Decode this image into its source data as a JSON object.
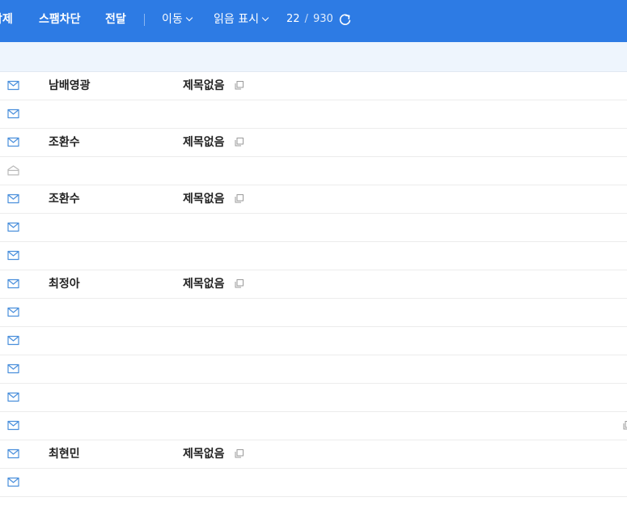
{
  "toolbar": {
    "delete_label": "삭제",
    "spam_label": "스팸차단",
    "forward_label": "전달",
    "move_label": "이동",
    "mark_label": "읽음 표시",
    "page_current": "22",
    "page_separator": "/",
    "page_total": "930",
    "refresh_icon": "refresh-icon",
    "bg_color": "#2d7be4"
  },
  "mail_list": {
    "rows": [
      {
        "sender": "남배영광",
        "subject": "제목없음",
        "icon": "envelope-icon"
      },
      {
        "sender": "",
        "subject": "",
        "icon": "envelope-icon"
      },
      {
        "sender": "조환수",
        "subject": "제목없음",
        "icon": "envelope-icon"
      },
      {
        "sender": "",
        "subject": "",
        "icon": "envelope-open-icon"
      },
      {
        "sender": "조환수",
        "subject": "제목없음",
        "icon": "envelope-icon"
      },
      {
        "sender": "",
        "subject": "",
        "icon": "envelope-icon"
      },
      {
        "sender": "",
        "subject": "",
        "icon": "envelope-icon"
      },
      {
        "sender": "최정아",
        "subject": "제목없음",
        "icon": "envelope-icon"
      },
      {
        "sender": "",
        "subject": "",
        "icon": "envelope-icon"
      },
      {
        "sender": "",
        "subject": "",
        "icon": "envelope-icon"
      },
      {
        "sender": "",
        "subject": "",
        "icon": "envelope-icon"
      },
      {
        "sender": "",
        "subject": "",
        "icon": "envelope-icon"
      },
      {
        "sender": "",
        "subject": "",
        "icon": "envelope-icon"
      },
      {
        "sender": "최현민",
        "subject": "제목없음",
        "icon": "envelope-icon"
      },
      {
        "sender": "",
        "subject": "",
        "icon": "envelope-icon"
      }
    ]
  }
}
